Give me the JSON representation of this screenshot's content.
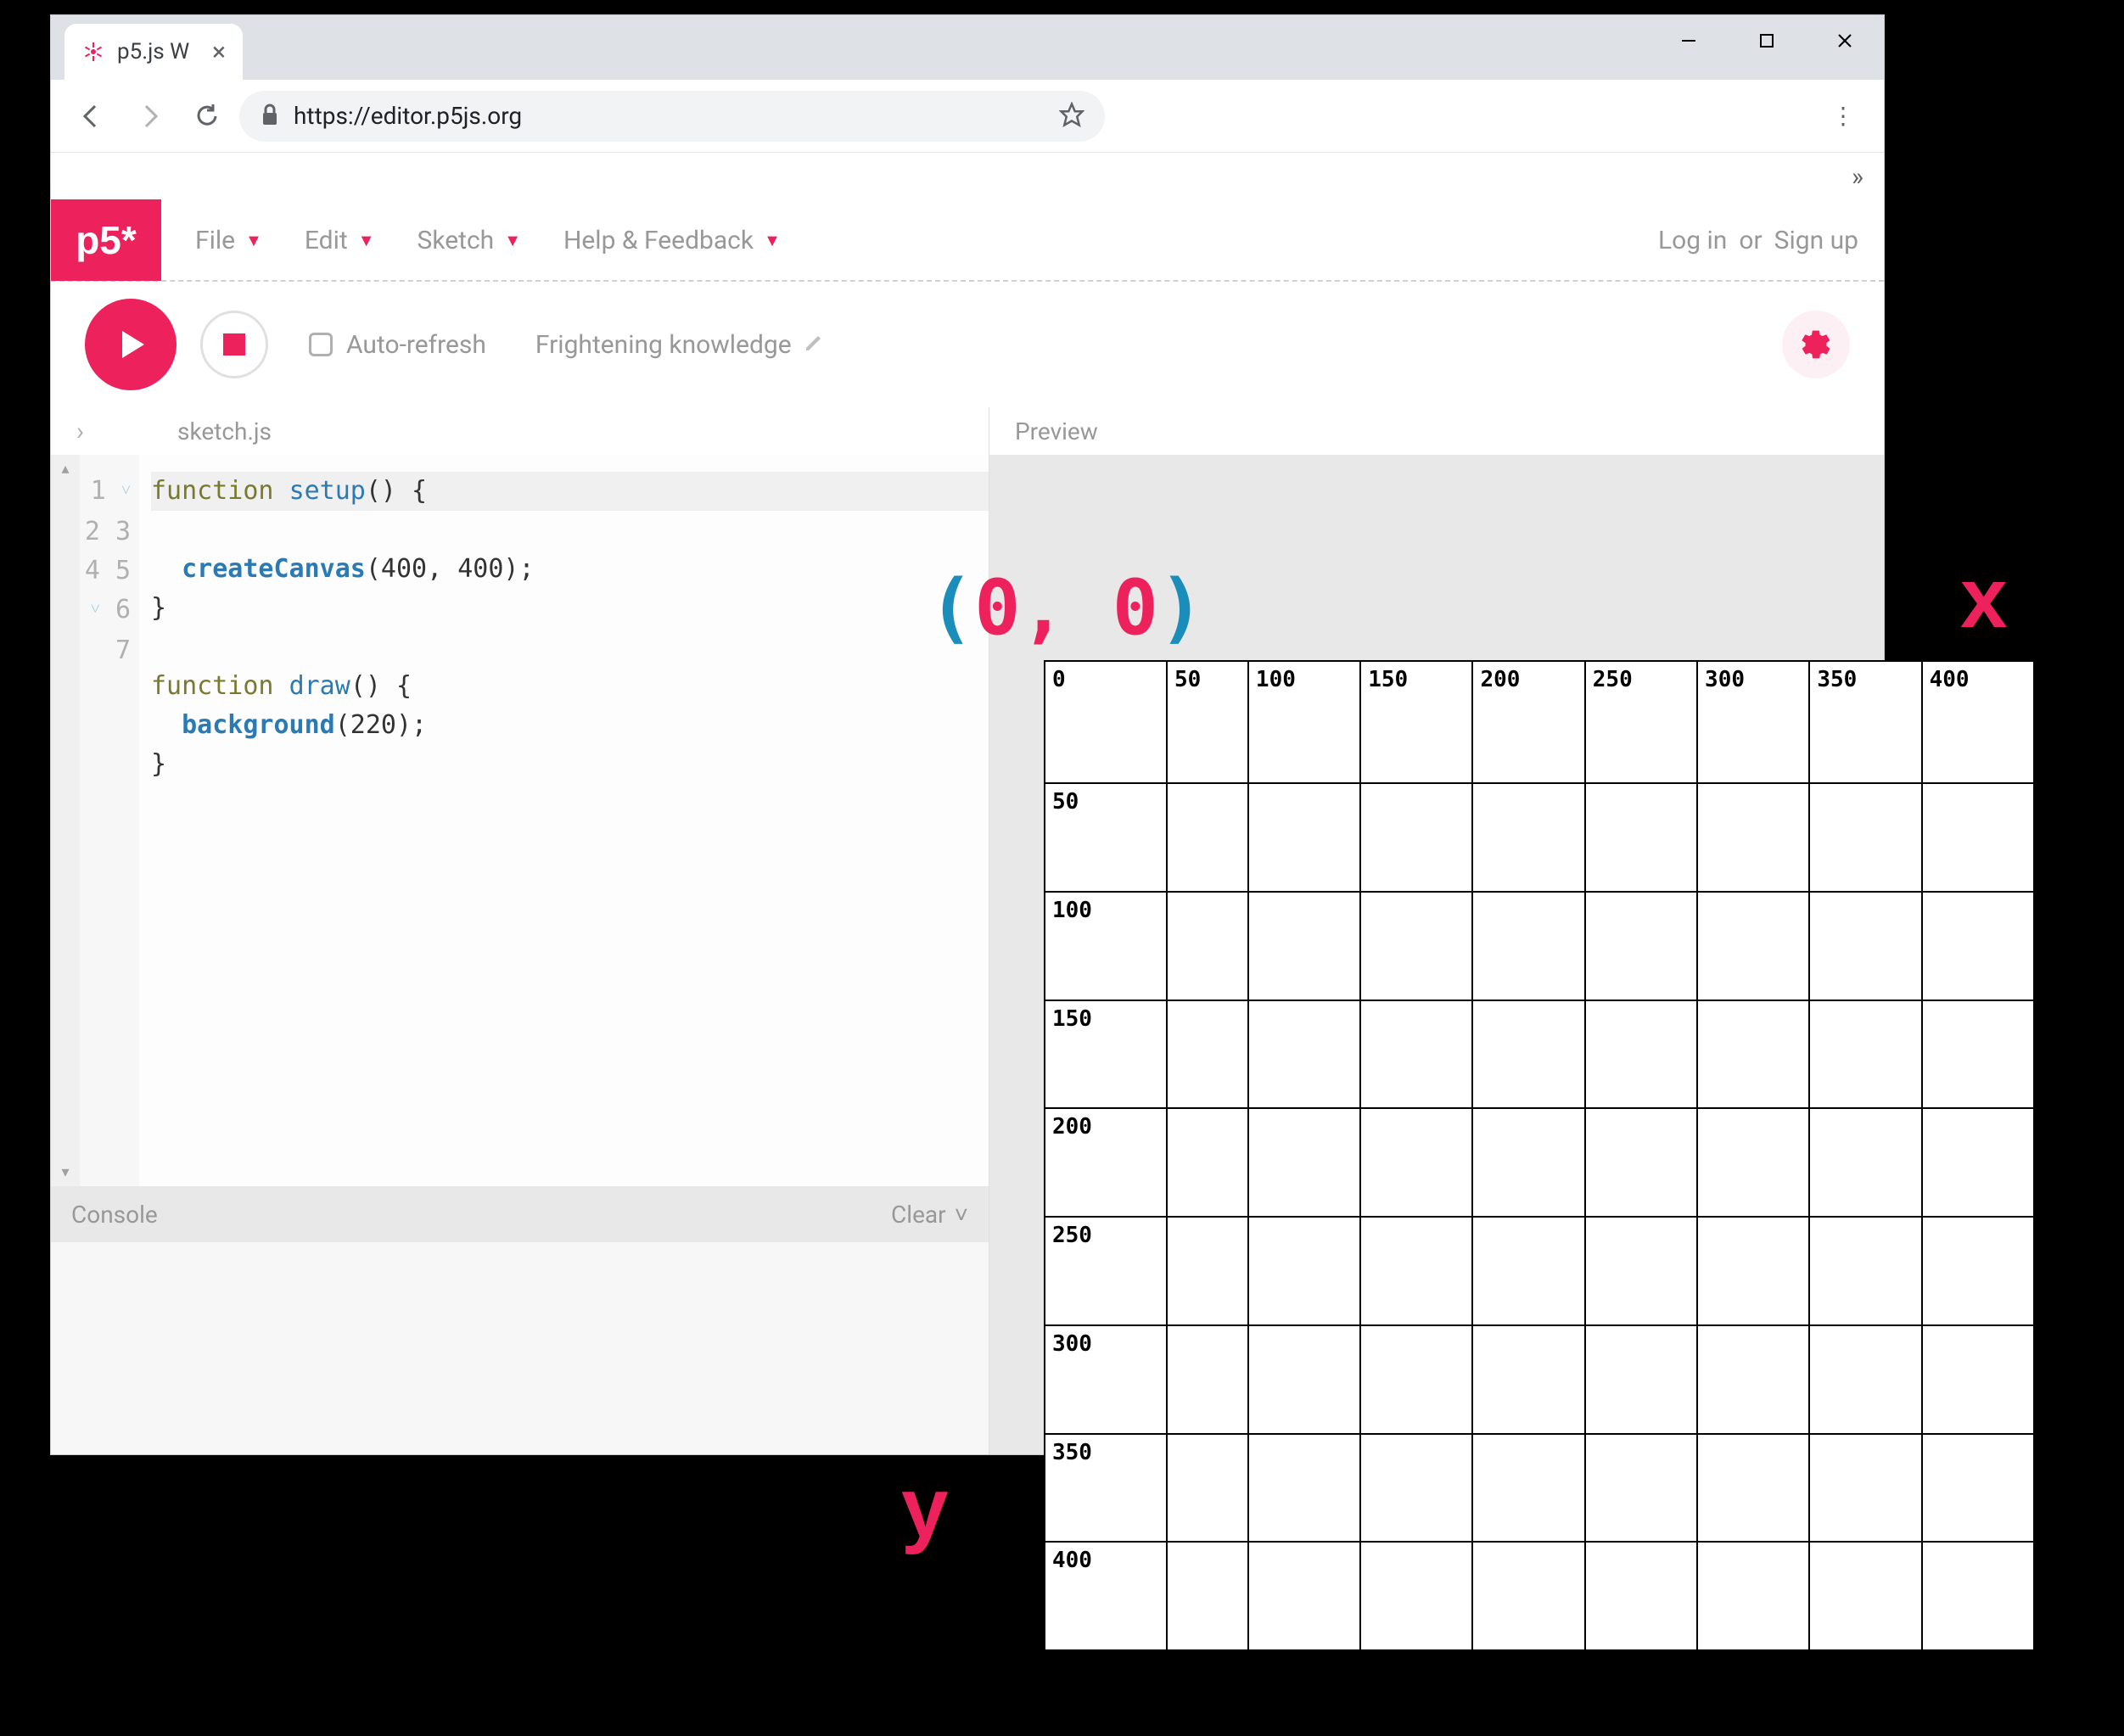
{
  "browser": {
    "tab_title": "p5.js W",
    "url": "https://editor.p5js.org"
  },
  "p5_menus": {
    "logo": "p5*",
    "items": [
      "File",
      "Edit",
      "Sketch",
      "Help & Feedback"
    ],
    "login": "Log in",
    "or": "or",
    "signup": "Sign up"
  },
  "toolbar": {
    "auto_refresh": "Auto-refresh",
    "sketch_name": "Frightening knowledge"
  },
  "editor": {
    "filename": "sketch.js",
    "preview_label": "Preview",
    "line_numbers": [
      "1",
      "2",
      "3",
      "4",
      "5",
      "6",
      "7"
    ],
    "code": {
      "l1_a": "function ",
      "l1_b": "setup",
      "l1_c": "() {",
      "l2_a": "  ",
      "l2_b": "createCanvas",
      "l2_c": "(400, 400);",
      "l3": "}",
      "l4": "",
      "l5_a": "function ",
      "l5_b": "draw",
      "l5_c": "() {",
      "l6_a": "  ",
      "l6_b": "background",
      "l6_c": "(220);",
      "l7": "}"
    },
    "console_label": "Console",
    "clear_label": "Clear"
  },
  "annotation": {
    "origin_open": "(",
    "origin_z1": "0",
    "origin_comma": ",",
    "origin_z2": "0",
    "origin_close": ")",
    "x_axis": "x",
    "y_axis": "y"
  },
  "grid": {
    "ticks": [
      "0",
      "50",
      "100",
      "150",
      "200",
      "250",
      "300",
      "350",
      "400"
    ]
  }
}
